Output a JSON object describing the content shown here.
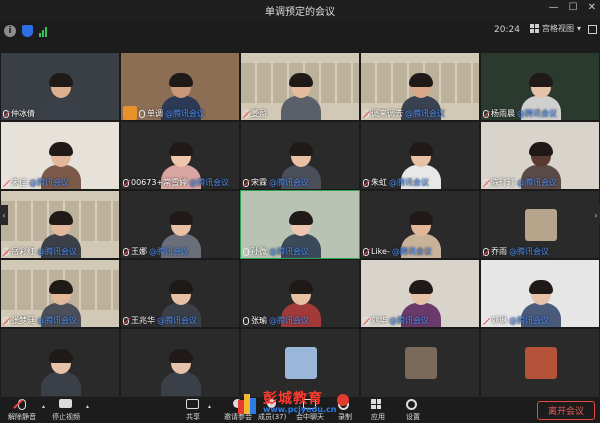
{
  "window": {
    "title": "单调预定的会议",
    "controls": {
      "minimize": "—",
      "maximize": "☐",
      "close": "✕"
    }
  },
  "status": {
    "time": "20:24",
    "view_label": "宫格视图",
    "view_caret": "▾",
    "info_glyph": "i",
    "tencent_suffix": "@腾讯会议"
  },
  "participants": [
    {
      "name": "仲冰倩",
      "muted": true,
      "tencent": false
    },
    {
      "name": "单调",
      "muted": false,
      "tencent": true,
      "hand_raised": true
    },
    {
      "name": "姜盈",
      "muted": true,
      "tencent": false
    },
    {
      "name": "调来调去",
      "muted": true,
      "tencent": true
    },
    {
      "name": "杨雨晨",
      "muted": true,
      "tencent": true
    },
    {
      "name": "宋佳",
      "muted": true,
      "tencent": true
    },
    {
      "name": "00673+常雪婷",
      "muted": true,
      "tencent": true
    },
    {
      "name": "宋霖",
      "muted": true,
      "tencent": true
    },
    {
      "name": "朱虹",
      "muted": true,
      "tencent": true
    },
    {
      "name": "陈玎玎",
      "muted": true,
      "tencent": true
    },
    {
      "name": "岳彩红",
      "muted": true,
      "tencent": true
    },
    {
      "name": "王娜",
      "muted": true,
      "tencent": true
    },
    {
      "name": "孙微",
      "muted": false,
      "tencent": true
    },
    {
      "name": "Like-",
      "muted": true,
      "tencent": true
    },
    {
      "name": "乔雨",
      "muted": true,
      "tencent": true
    },
    {
      "name": "张梦廷",
      "muted": true,
      "tencent": true
    },
    {
      "name": "王兆华",
      "muted": true,
      "tencent": true
    },
    {
      "name": "张瑜",
      "muted": false,
      "tencent": true
    },
    {
      "name": "刘华",
      "muted": true,
      "tencent": true
    },
    {
      "name": "刘琳",
      "muted": true,
      "tencent": true
    }
  ],
  "toolbar": {
    "mute_label": "解除静音",
    "video_label": "停止视频",
    "share_label": "共享",
    "invite_label": "邀请参会",
    "members_label": "成员(37)",
    "chat_label": "会中聊天",
    "record_label": "录制",
    "apps_label": "应用",
    "settings_label": "设置",
    "leave_label": "离开会议",
    "caret": "▴"
  },
  "navigation": {
    "prev": "‹",
    "next": "›"
  },
  "watermark": {
    "cn": "彭城教育",
    "url": "www.pcjyedu.cn"
  },
  "colors": {
    "accent": "#2f6fe4",
    "active_border": "#2f9e4f",
    "leave": "#e64848",
    "tencent_label": "#4d8ff5"
  }
}
